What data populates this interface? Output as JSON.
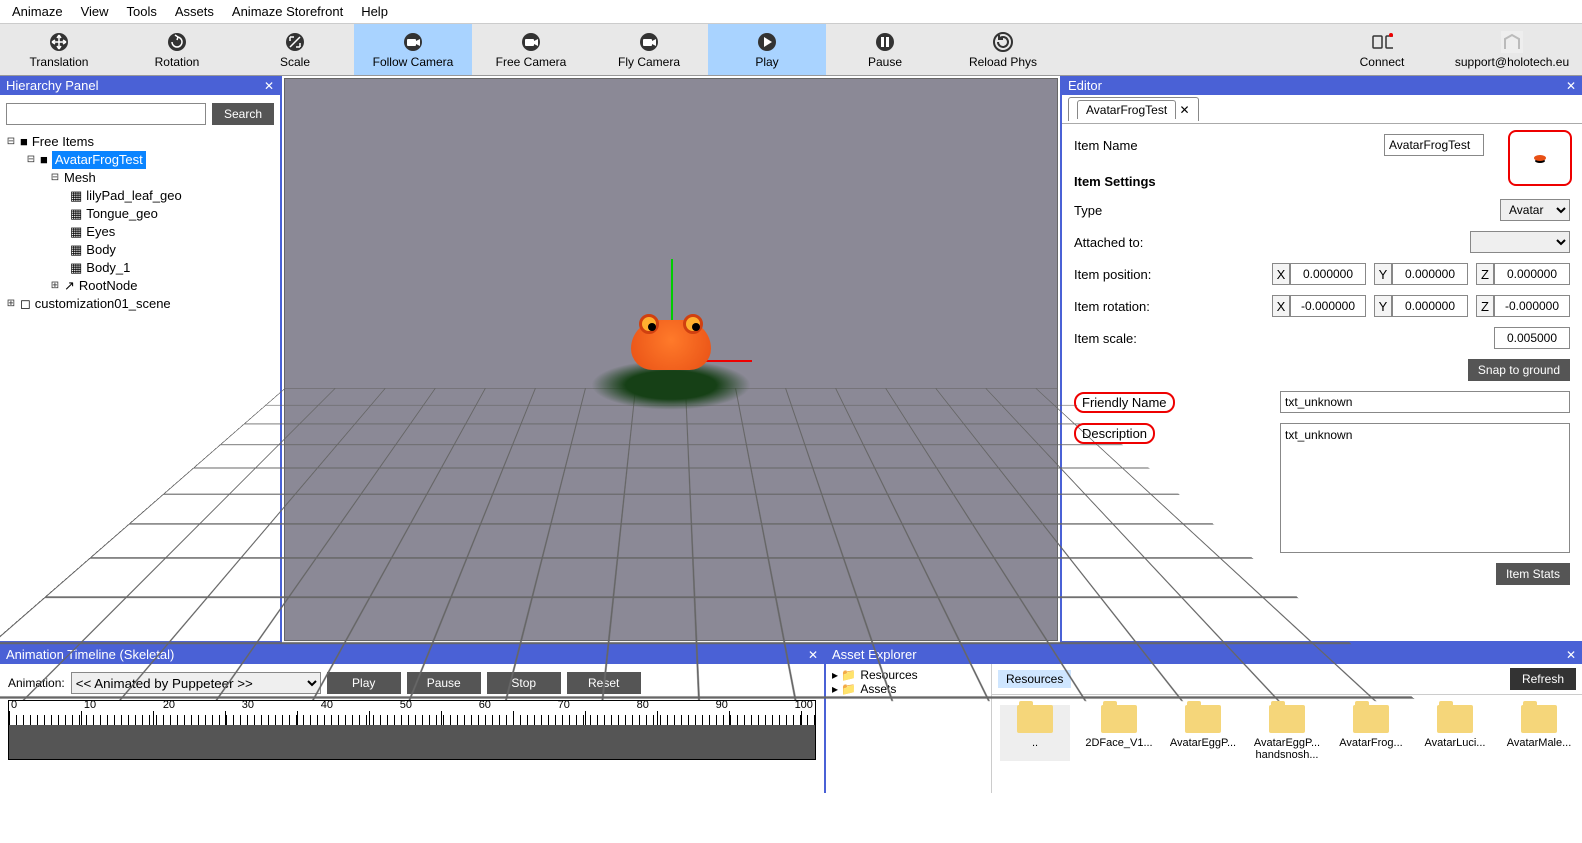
{
  "menu": [
    "Animaze",
    "View",
    "Tools",
    "Assets",
    "Animaze Storefront",
    "Help"
  ],
  "toolbar": {
    "translation": "Translation",
    "rotation": "Rotation",
    "scale": "Scale",
    "follow_camera": "Follow Camera",
    "free_camera": "Free Camera",
    "fly_camera": "Fly Camera",
    "play": "Play",
    "pause": "Pause",
    "reload_phys": "Reload Phys",
    "connect": "Connect",
    "support_email": "support@holotech.eu"
  },
  "hierarchy": {
    "title": "Hierarchy Panel",
    "search_btn": "Search",
    "root": "Free Items",
    "avatar": "AvatarFrogTest",
    "mesh": "Mesh",
    "meshes": [
      "lilyPad_leaf_geo",
      "Tongue_geo",
      "Eyes",
      "Body",
      "Body_1"
    ],
    "rootnode": "RootNode",
    "custom": "customization01_scene"
  },
  "editor": {
    "title": "Editor",
    "tab": "AvatarFrogTest",
    "item_name_lbl": "Item Name",
    "item_name_val": "AvatarFrogTest",
    "settings_header": "Item Settings",
    "type_lbl": "Type",
    "type_val": "Avatar",
    "attached_lbl": "Attached to:",
    "attached_val": "",
    "pos_lbl": "Item position:",
    "rot_lbl": "Item rotation:",
    "scale_lbl": "Item scale:",
    "pos": {
      "x": "0.000000",
      "y": "0.000000",
      "z": "0.000000"
    },
    "rot": {
      "x": "-0.000000",
      "y": "0.000000",
      "z": "-0.000000"
    },
    "scale_val": "0.005000",
    "snap_btn": "Snap to ground",
    "friendly_lbl": "Friendly Name",
    "friendly_val": "txt_unknown",
    "desc_lbl": "Description",
    "desc_val": "txt_unknown",
    "stats_btn": "Item Stats"
  },
  "timeline": {
    "title": "Animation Timeline (Skeletal)",
    "anim_lbl": "Animation:",
    "anim_val": "<< Animated by Puppeteer >>",
    "play": "Play",
    "pause": "Pause",
    "stop": "Stop",
    "reset": "Reset",
    "ticks": [
      "0",
      "10",
      "20",
      "30",
      "40",
      "50",
      "60",
      "70",
      "80",
      "90",
      "100"
    ]
  },
  "assets": {
    "title": "Asset Explorer",
    "tree": [
      "Resources",
      "Assets"
    ],
    "tab": "Resources",
    "refresh": "Refresh",
    "items": [
      "..",
      "2DFace_V1...",
      "AvatarEggP...",
      "AvatarEggP... handsnosh...",
      "AvatarFrog...",
      "AvatarLuci...",
      "AvatarMale..."
    ]
  }
}
